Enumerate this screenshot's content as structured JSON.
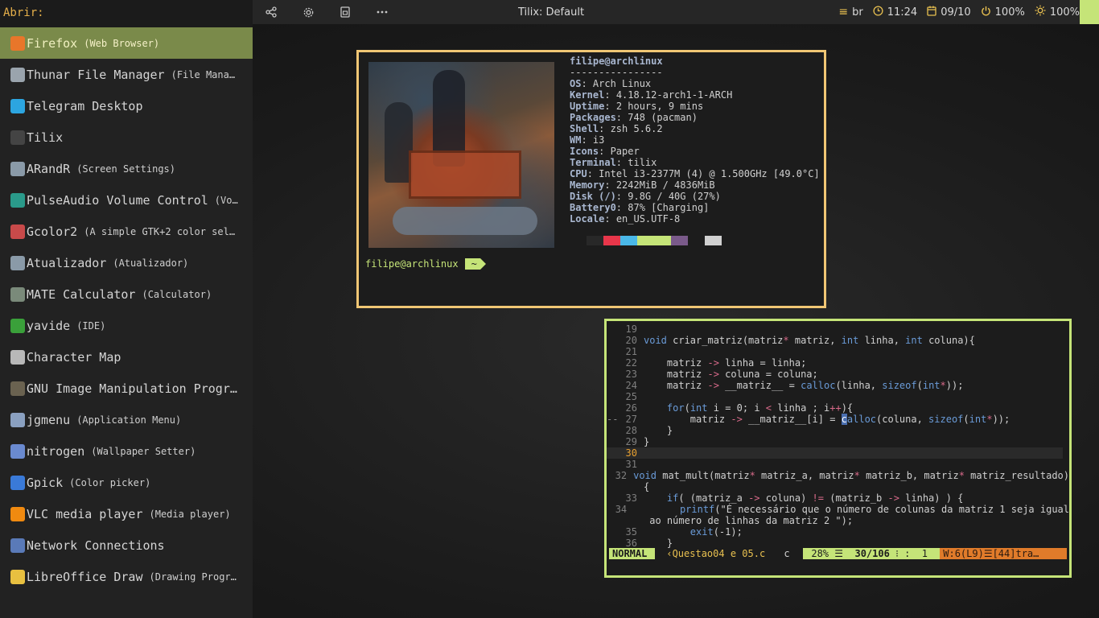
{
  "topbar": {
    "title": "Tilix: Default",
    "icons": [
      "share-icon",
      "gear-icon",
      "save-icon",
      "more-icon"
    ],
    "keyboard_layout": "br",
    "time": "11:24",
    "date": "09/10",
    "battery": "100%",
    "brightness": "100%"
  },
  "launcher": {
    "prompt": "Abrir:",
    "items": [
      {
        "name": "Firefox",
        "desc": "(Web Browser)",
        "icon": "firefox-icon",
        "icon_color": "#e8762a"
      },
      {
        "name": "Thunar File Manager",
        "desc": "(File Mana…",
        "icon": "folder-icon",
        "icon_color": "#9aa4ad"
      },
      {
        "name": "Telegram Desktop",
        "desc": "",
        "icon": "telegram-icon",
        "icon_color": "#2ca5e0"
      },
      {
        "name": "Tilix",
        "desc": "",
        "icon": "terminal-icon",
        "icon_color": "#444444"
      },
      {
        "name": "ARandR",
        "desc": "(Screen Settings)",
        "icon": "display-icon",
        "icon_color": "#8a9aa8"
      },
      {
        "name": "PulseAudio Volume Control",
        "desc": "(Vo…",
        "icon": "volume-icon",
        "icon_color": "#2a9a8a"
      },
      {
        "name": "Gcolor2",
        "desc": "(A simple GTK+2 color sele…",
        "icon": "color-cube-icon",
        "icon_color": "#c84a4a"
      },
      {
        "name": "Atualizador",
        "desc": "(Atualizador)",
        "icon": "updater-icon",
        "icon_color": "#8a9aa8"
      },
      {
        "name": "MATE Calculator",
        "desc": "(Calculator)",
        "icon": "calculator-icon",
        "icon_color": "#7a8a7a"
      },
      {
        "name": "yavide",
        "desc": "(IDE)",
        "icon": "vim-icon",
        "icon_color": "#3aa03a"
      },
      {
        "name": "Character Map",
        "desc": "",
        "icon": "charmap-icon",
        "icon_color": "#b8b8b8"
      },
      {
        "name": "GNU Image Manipulation Progr…",
        "desc": "",
        "icon": "gimp-icon",
        "icon_color": "#6a6250"
      },
      {
        "name": "jgmenu",
        "desc": "(Application Menu)",
        "icon": "rocket-icon",
        "icon_color": "#8aa0c0"
      },
      {
        "name": "nitrogen",
        "desc": "(Wallpaper Setter)",
        "icon": "nitrogen-icon",
        "icon_color": "#6a8ad0"
      },
      {
        "name": "Gpick",
        "desc": "(Color picker)",
        "icon": "gpick-icon",
        "icon_color": "#3a7ad8"
      },
      {
        "name": "VLC media player",
        "desc": "(Media player)",
        "icon": "vlc-icon",
        "icon_color": "#f08a10"
      },
      {
        "name": "Network Connections",
        "desc": "",
        "icon": "network-icon",
        "icon_color": "#5a7ab8"
      },
      {
        "name": "LibreOffice Draw",
        "desc": "(Drawing Progr…",
        "icon": "draw-icon",
        "icon_color": "#e8c040"
      }
    ]
  },
  "neofetch": {
    "user": "filipe@archlinux",
    "separator": "----------------",
    "fields": [
      {
        "k": "OS",
        "v": "Arch Linux"
      },
      {
        "k": "Kernel",
        "v": "4.18.12-arch1-1-ARCH"
      },
      {
        "k": "Uptime",
        "v": "2 hours, 9 mins"
      },
      {
        "k": "Packages",
        "v": "748 (pacman)"
      },
      {
        "k": "Shell",
        "v": "zsh 5.6.2"
      },
      {
        "k": "WM",
        "v": "i3"
      },
      {
        "k": "Icons",
        "v": "Paper"
      },
      {
        "k": "Terminal",
        "v": "tilix"
      },
      {
        "k": "CPU",
        "v": "Intel i3-2377M (4) @ 1.500GHz [49.0°C]"
      },
      {
        "k": "Memory",
        "v": "2242MiB / 4836MiB"
      },
      {
        "k": "Disk (/)",
        "v": "9.8G / 40G (27%)"
      },
      {
        "k": "Battery0",
        "v": "87% [Charging]"
      },
      {
        "k": "Locale",
        "v": "en_US.UTF-8"
      }
    ],
    "swatches": [
      "#1c1c1c",
      "#282828",
      "#e8364a",
      "#4ab8e8",
      "#c5e478",
      "#c5e478",
      "#7a5a8a",
      "#1c1c1c",
      "#d0d0d0"
    ],
    "prompt_user": "filipe@archlinux",
    "prompt_dir": "~"
  },
  "vim": {
    "lines": [
      {
        "n": "19",
        "t": ""
      },
      {
        "n": "20",
        "t": "void criar_matriz(matriz* matriz, int linha, int coluna){"
      },
      {
        "n": "21",
        "t": ""
      },
      {
        "n": "22",
        "t": "    matriz -> linha = linha;"
      },
      {
        "n": "23",
        "t": "    matriz -> coluna = coluna;"
      },
      {
        "n": "24",
        "t": "    matriz -> __matriz__ = calloc(linha, sizeof(int*));"
      },
      {
        "n": "25",
        "t": ""
      },
      {
        "n": "26",
        "t": "    for(int i = 0; i < linha ; i++){"
      },
      {
        "n": "27",
        "t": "        matriz -> __matriz__[i] = calloc(coluna, sizeof(int*));",
        "sign": "--"
      },
      {
        "n": "28",
        "t": "    }"
      },
      {
        "n": "29",
        "t": "}"
      },
      {
        "n": "30",
        "t": "",
        "current": true
      },
      {
        "n": "31",
        "t": ""
      },
      {
        "n": "32",
        "t": "void mat_mult(matriz* matriz_a, matriz* matriz_b, matriz* matriz_resultado)"
      },
      {
        "n": "",
        "t": "{"
      },
      {
        "n": "33",
        "t": "    if( (matriz_a -> coluna) != (matriz_b -> linha) ) {"
      },
      {
        "n": "34",
        "t": "        printf(\"É necessário que o número de colunas da matriz 1 seja igual"
      },
      {
        "n": "",
        "t": " ao número de linhas da matriz 2 \");"
      },
      {
        "n": "35",
        "t": "        exit(-1);"
      },
      {
        "n": "36",
        "t": "    }"
      }
    ],
    "status": {
      "mode": "NORMAL",
      "file": "‹Questao04 e 05.c",
      "filetype": "c",
      "percent": "28%",
      "position": "30/106",
      "column": "1",
      "warning": "W:6(L9)☰[44]tra…"
    }
  }
}
